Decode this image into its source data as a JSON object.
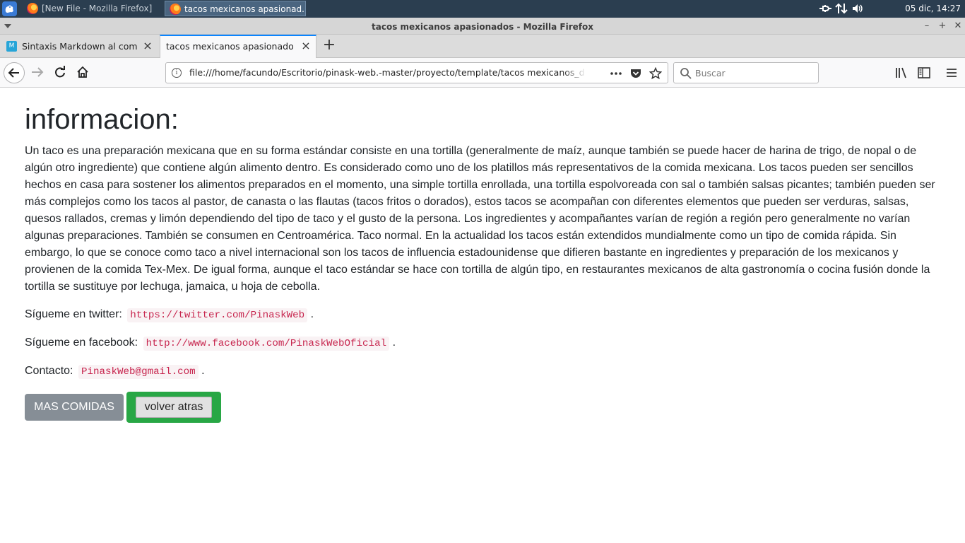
{
  "taskbar": {
    "tasks": [
      {
        "label": "[New File - Mozilla Firefox]"
      },
      {
        "label": "tacos mexicanos apasionad..."
      }
    ],
    "clock": "05 dic, 14:27"
  },
  "window": {
    "title": "tacos mexicanos apasionados - Mozilla Firefox"
  },
  "tabs": [
    {
      "label": "Sintaxis Markdown al completo",
      "favicon_letter": "M"
    },
    {
      "label": "tacos mexicanos apasionados"
    }
  ],
  "navbar": {
    "url": "file:///home/facundo/Escritorio/pinask-web.-master/proyecto/template/tacos mexicanos_detalles.html",
    "search_placeholder": "Buscar"
  },
  "page": {
    "title": "informacion:",
    "body": "Un taco es una preparación mexicana que en su forma estándar consiste en una tortilla (generalmente de maíz, aunque también se puede hacer de harina de trigo, de nopal o de algún otro ingrediente) que contiene algún alimento dentro. Es considerado como uno de los platillos más representativos de la comida mexicana. Los tacos pueden ser sencillos hechos en casa para sostener los alimentos preparados en el momento, una simple tortilla enrollada, una tortilla espolvoreada con sal o también salsas picantes; también pueden ser más complejos como los tacos al pastor, de canasta o las flautas (tacos fritos o dorados), estos tacos se acompañan con diferentes elementos que pueden ser verduras, salsas, quesos rallados, cremas y limón dependiendo del tipo de taco y el gusto de la persona. Los ingredientes y acompañantes varían de región a región pero generalmente no varían algunas preparaciones. También se consumen en Centroamérica. Taco normal. En la actualidad los tacos están extendidos mundialmente como un tipo de comida rápida. Sin embargo, lo que se conoce como taco a nivel internacional son los tacos de influencia estadounidense que difieren bastante en ingredientes y preparación de los mexicanos y provienen de la comida Tex-Mex. De igual forma, aunque el taco estándar se hace con tortilla de algún tipo, en restaurantes mexicanos de alta gastronomía o cocina fusión donde la tortilla se sustituye por lechuga, jamaica, u hoja de cebolla.",
    "twitter_label": "Sígueme en twitter:",
    "twitter_link": "https://twitter.com/PinaskWeb",
    "facebook_label": "Sígueme en facebook:",
    "facebook_link": "http://www.facebook.com/PinaskWebOficial",
    "contact_label": "Contacto:",
    "contact_email": "PinaskWeb@gmail.com",
    "period": ".",
    "btn_mas": "MAS COMIDAS",
    "btn_volver": "volver atras"
  },
  "colors": {
    "accent_tab": "#0a84ff",
    "btn_secondary": "#868e96",
    "btn_success": "#28a745",
    "code_text": "#c7254e"
  }
}
